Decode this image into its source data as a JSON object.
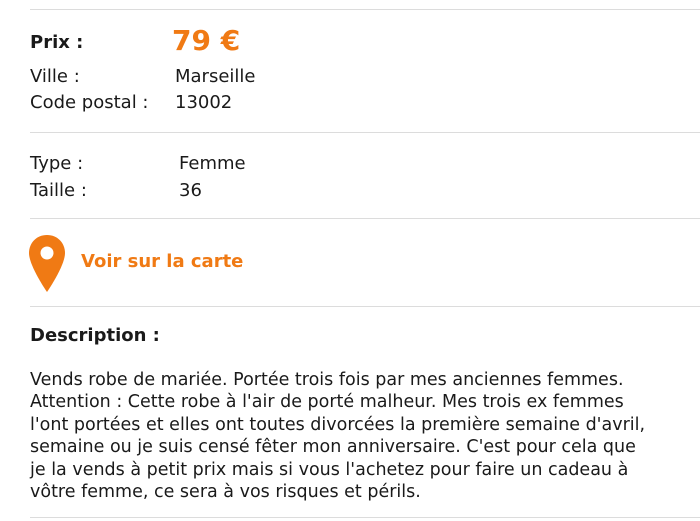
{
  "listing": {
    "price_label": "Prix :",
    "price_value": "79 €",
    "city_label": "Ville :",
    "city_value": "Marseille",
    "postal_label": "Code postal :",
    "postal_value": "13002",
    "type_label": "Type :",
    "type_value": "Femme",
    "size_label": "Taille :",
    "size_value": "36",
    "map_link": "Voir sur la carte",
    "map_icon": "map-pin-icon",
    "description_title": "Description :",
    "description_text": "Vends robe de mariée. Portée trois fois par mes anciennes femmes.\nAttention : Cette robe à l'air de porté malheur. Mes trois ex femmes\nl'ont portées et elles ont toutes divorcées la première semaine d'avril,\nsemaine ou je suis censé fêter mon anniversaire. C'est pour cela que\nje la vends à petit prix mais si vous l'achetez pour faire un cadeau à\nvôtre femme, ce sera à vos risques et périls."
  },
  "colors": {
    "accent": "#f07a14",
    "divider": "#dcdcdc",
    "text": "#1a1a1a"
  }
}
